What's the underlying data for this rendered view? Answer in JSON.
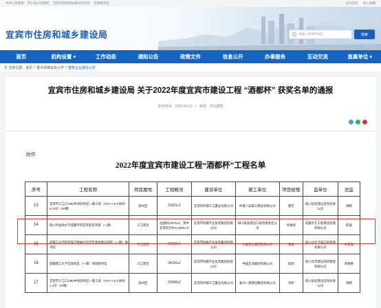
{
  "topbar": {
    "links": [
      "中央人民政府",
      "四川省人民政府",
      "宜宾市政府网站集约化平台",
      "无障碍浏览"
    ],
    "right": [
      "设为首页",
      "加入收藏"
    ]
  },
  "header": {
    "site_title": "宜宾市住房和城乡建设局",
    "search_placeholder": "请输入关键字搜索",
    "search_button": "搜索"
  },
  "nav": {
    "items": [
      "首页",
      "机构设置 ▾",
      "工作动态",
      "通知公告",
      "政策文件",
      "信息公开",
      "办事服务",
      "互动交流",
      "直属单位 ▾"
    ]
  },
  "breadcrumb": {
    "label": "当前位置：",
    "path": [
      "首页",
      "重点领域信息公开",
      "建筑企业诚信公告"
    ]
  },
  "article": {
    "title": "宜宾市住房和城乡建设局 关于2022年度宜宾市建设工程 “酒都杯” 获奖名单的通报",
    "date": "发布时间：2023-04-13",
    "source": "来源：市住建局",
    "attachment": "附件",
    "doc_title": "2022年度宜宾市建设工程“酒都杯”工程名单"
  },
  "table": {
    "headers": [
      "序号",
      "工程名称",
      "项目属地",
      "工程概况",
      "建设单位",
      "施工单位",
      "项目经理",
      "监单位",
      "总监"
    ],
    "rows": [
      {
        "no": "13",
        "name": "宜宾市三江口CBD中央商务区一期工程（STK-A-5-2地块）5-10号（6#楼）",
        "area": "叙州区",
        "scale": "21621㎡",
        "builder": "宜宾华侨城三江置业有限公司",
        "contractor": "中建八局第三建设有限公司",
        "manager": "唐忠",
        "supervisor": "四川良友建设咨询有限公司",
        "chief": "杨鹤"
      },
      {
        "no": "14",
        "name": "四川外国语大学成都学院宜宾校区项目（一期）",
        "area": "三江新区",
        "scale": "总面积21875㎡，其中宜宾综合中心15081㎡",
        "builder": "宜宾市科教产业投资集团有限公司",
        "contractor": "四川航岗建设工程有限责任公司",
        "manager": "何裕莉",
        "supervisor": "成都大元工程建设监理有限公司",
        "chief": "陈钺"
      },
      {
        "no": "15",
        "name": "成都工业学院宜宾产教融合示范区基地建设项目（一期）图书馆",
        "area": "三江新区",
        "scale": "27022㎡",
        "builder": "宜宾市科教产业投资集团有限公司",
        "contractor": "中国五冶集团有限公司",
        "manager": "蒋斌",
        "supervisor": "四川众信佳诚工程管理有限公司",
        "chief": "钟先强"
      },
      {
        "no": "16",
        "name": "成都理工大学宜宾校区（一期）项目图书馆",
        "area": "三江新区",
        "scale": "34116㎡",
        "builder": "宜宾市科教产业投资集团有限公司",
        "contractor": "中国五冶集团有限公司",
        "manager": "彭明",
        "supervisor": "四川元丰建设项目管理有限公司",
        "chief": "宋德勇"
      },
      {
        "no": "17",
        "name": "宜宾市三江口CBD中央商务区一期工程（STK-A-5-2地块）1-4号（4#楼）",
        "area": "叙州区",
        "scale": "31668㎡",
        "builder": "宜宾华侨城三江置业有限公司",
        "contractor": "泰兴一建建设集团有限公司",
        "manager": "邓辉",
        "supervisor": "四川良友建设咨询有限公司",
        "chief": "杨鹤"
      }
    ]
  },
  "colors": {
    "brand": "#1a5fb4",
    "nav": "#1565c0",
    "highlight": "#e0303a"
  }
}
